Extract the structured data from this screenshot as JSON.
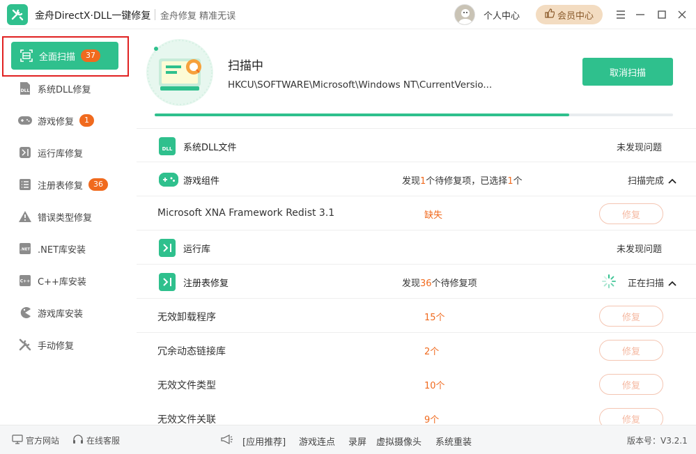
{
  "app": {
    "title": "金舟DirectX·DLL一键修复",
    "slogan": "金舟修复 精准无误",
    "personal_center": "个人中心",
    "vip_center": "会员中心",
    "brand_color": "#2fc08d",
    "accent_color": "#f06a1e"
  },
  "window_controls": [
    "menu-icon",
    "minimize-icon",
    "maximize-icon",
    "close-icon"
  ],
  "sidebar": {
    "items": [
      {
        "label": "全面扫描",
        "badge": "37",
        "icon": "scan-icon",
        "active": true
      },
      {
        "label": "系统DLL修复",
        "badge": "",
        "icon": "dll-icon"
      },
      {
        "label": "游戏修复",
        "badge": "1",
        "icon": "gamepad-icon"
      },
      {
        "label": "运行库修复",
        "badge": "",
        "icon": "runtime-icon"
      },
      {
        "label": "注册表修复",
        "badge": "36",
        "icon": "registry-icon"
      },
      {
        "label": "错误类型修复",
        "badge": "",
        "icon": "warning-icon"
      },
      {
        "label": ".NET库安装",
        "badge": "",
        "icon": "dotnet-icon"
      },
      {
        "label": "C++库安装",
        "badge": "",
        "icon": "cpp-icon"
      },
      {
        "label": "游戏库安装",
        "badge": "",
        "icon": "pacman-icon"
      },
      {
        "label": "手动修复",
        "badge": "",
        "icon": "wrench-icon"
      }
    ]
  },
  "scan": {
    "title": "扫描中",
    "path": "HKCU\\SOFTWARE\\Microsoft\\Windows NT\\CurrentVersio...",
    "cancel_label": "取消扫描",
    "progress": 0.8
  },
  "sections": {
    "dll": {
      "title": "系统DLL文件",
      "status": "未发现问题",
      "icon_text": "DLL"
    },
    "game": {
      "title": "游戏组件",
      "summary_pre": "发现",
      "summary_count": "1",
      "summary_mid": "个待修复项，已选择",
      "summary_sel": "1",
      "summary_post": "个",
      "status": "扫描完成",
      "items": [
        {
          "name": "Microsoft XNA Framework Redist 3.1",
          "value": "缺失",
          "action": "修复"
        }
      ]
    },
    "runtime": {
      "title": "运行库",
      "status": "未发现问题"
    },
    "registry": {
      "title": "注册表修复",
      "summary_pre": "发现",
      "summary_count": "36",
      "summary_post": "个待修复项",
      "status": "正在扫描",
      "items": [
        {
          "name": "无效卸载程序",
          "value": "15个",
          "action": "修复"
        },
        {
          "name": "冗余动态链接库",
          "value": "2个",
          "action": "修复"
        },
        {
          "name": "无效文件类型",
          "value": "10个",
          "action": "修复"
        },
        {
          "name": "无效文件关联",
          "value": "9个",
          "action": "修复"
        }
      ]
    }
  },
  "footer": {
    "website": "官方网站",
    "support": "在线客服",
    "recommend": "[应用推荐]",
    "links": [
      "游戏连点",
      "录屏",
      "虚拟摄像头",
      "系统重装"
    ],
    "version": "版本号：V3.2.1"
  }
}
